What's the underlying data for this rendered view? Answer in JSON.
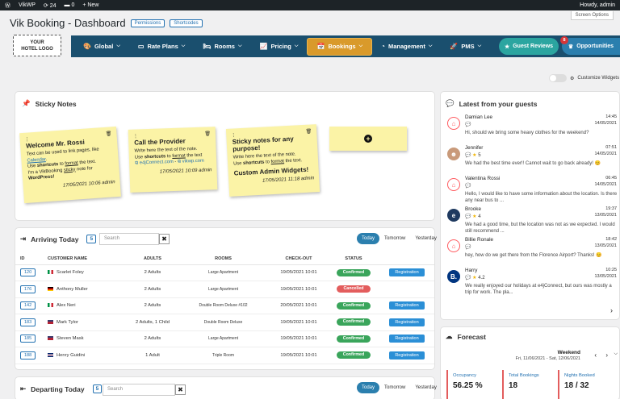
{
  "wpbar": {
    "site": "VikWP",
    "updates": "24",
    "comments": "0",
    "new": "+ New",
    "howdy": "Howdy, admin"
  },
  "screen_options": "Screen Options",
  "page": {
    "title": "Vik Booking - Dashboard",
    "pill1": "Permissions",
    "pill2": "Shortcodes"
  },
  "logo": {
    "line1": "YOUR",
    "line2": "HOTEL LOGO"
  },
  "nav": {
    "items": [
      {
        "label": "Global",
        "icon": "palette-icon"
      },
      {
        "label": "Rate Plans",
        "icon": "card-icon"
      },
      {
        "label": "Rooms",
        "icon": "bed-icon"
      },
      {
        "label": "Pricing",
        "icon": "chart-icon"
      },
      {
        "label": "Bookings",
        "icon": "calendar-icon"
      },
      {
        "label": "Management",
        "icon": "pie-icon"
      },
      {
        "label": "PMS",
        "icon": "rocket-icon"
      }
    ],
    "guest_reviews": "Guest Reviews",
    "opportunities": "Opportunities",
    "opp_badge": "8"
  },
  "customize": "Customize Widgets",
  "sticky": {
    "title": "Sticky Notes",
    "notes": [
      {
        "title": "Welcome Mr. Rossi",
        "body1": "Text can be used to link pages, like",
        "link": "Calendar",
        "body2": "Use",
        "shortcuts": "shortcuts",
        "body3": "to",
        "format": "format",
        "body4": "the text.",
        "body5": "I'm a VikBooking",
        "sticky": "sticky",
        "body6": "note for",
        "wp": "WordPress!",
        "date": "17/05/2021 10:06 admin"
      },
      {
        "title": "Call the Provider",
        "body1": "Write here the text of the note.",
        "body2": "Use",
        "shortcuts": "shortcuts",
        "body3": "to",
        "format": "format",
        "body4": "the text",
        "link1": "e4jConnect.com",
        "sep": "-",
        "link2": "vikwp.com",
        "date": "17/05/2021 10:09 admin"
      },
      {
        "title": "Sticky notes for any purpose!",
        "body1": "Write here the text of the note.",
        "body2": "Use",
        "shortcuts": "shortcuts",
        "body3": "to",
        "format": "format",
        "body4": "the text.",
        "title2": "Custom Admin Widgets!",
        "date": "17/05/2021 11:18 admin"
      }
    ],
    "add": "+"
  },
  "arriving": {
    "title": "Arriving Today",
    "count": "5",
    "search": "Search",
    "tabs": [
      "Today",
      "Tomorrow",
      "Yesterday"
    ],
    "columns": [
      "ID",
      "CUSTOMER NAME",
      "ADULTS",
      "ROOMS",
      "CHECK-OUT",
      "STATUS"
    ],
    "rows": [
      {
        "id": "120",
        "name": "Scarlet Foley",
        "adults": "2 Adults",
        "room": "Large Apartment",
        "checkout": "19/05/2021 10:01",
        "status": "Confirmed",
        "action": "Registration",
        "flag": "it"
      },
      {
        "id": "176",
        "name": "Anthony Muller",
        "adults": "2 Adults",
        "room": "Large Apartment",
        "checkout": "19/05/2021 10:01",
        "status": "Cancelled",
        "action": "",
        "flag": "de"
      },
      {
        "id": "142",
        "name": "Alex Neri",
        "adults": "2 Adults",
        "room": "Double Room Deluxe #102",
        "checkout": "20/05/2021 10:01",
        "status": "Confirmed",
        "action": "Registration",
        "flag": "it"
      },
      {
        "id": "183",
        "name": "Mark Tylor",
        "adults": "2 Adults, 1 Child",
        "room": "Double Room Deluxe",
        "checkout": "19/05/2021 10:01",
        "status": "Confirmed",
        "action": "Registration",
        "flag": "us"
      },
      {
        "id": "185",
        "name": "Steven Mask",
        "adults": "2 Adults",
        "room": "Large Apartment",
        "checkout": "19/05/2021 10:01",
        "status": "Confirmed",
        "action": "Registration",
        "flag": "us"
      },
      {
        "id": "188",
        "name": "Henry Guidini",
        "adults": "1 Adult",
        "room": "Triple Room",
        "checkout": "19/05/2021 10:01",
        "status": "Confirmed",
        "action": "Registration",
        "flag": "uk"
      }
    ]
  },
  "departing": {
    "title": "Departing Today",
    "count": "5",
    "search": "Search",
    "tabs": [
      "Today",
      "Tomorrow",
      "Yesterday"
    ]
  },
  "guests": {
    "title": "Latest from your guests",
    "messages": [
      {
        "name": "Damian Lee",
        "time": "14:45",
        "date": "14/05/2021",
        "text": "Hi, should we bring some heavy clothes for the weekend?",
        "avatar": "airbnb",
        "stars": ""
      },
      {
        "name": "Jennifer",
        "time": "07:51",
        "date": "14/05/2021",
        "text": "We had the best time ever!! Cannot wait to go back already! 😊",
        "avatar": "photo",
        "stars": "5"
      },
      {
        "name": "Valentina Rossi",
        "time": "06:45",
        "date": "14/05/2021",
        "text": "Hello, I would like to have some information about the location. Is there any near bus to ...",
        "avatar": "airbnb",
        "stars": ""
      },
      {
        "name": "Brooke",
        "time": "19:37",
        "date": "13/05/2021",
        "text": "We had a good time, but the location was not as we expected. I would still recommend ...",
        "avatar": "expedia",
        "stars": "4"
      },
      {
        "name": "Billie Ronale",
        "time": "18:42",
        "date": "13/05/2021",
        "text": "hey, how do we get there from the Florence Airport? Thanks! 😊",
        "avatar": "airbnb",
        "stars": ""
      },
      {
        "name": "Harry",
        "time": "10:25",
        "date": "13/05/2021",
        "text": "We really enjoyed our holidays at e4jConnect, but ours was mostly a trip for work. The pla...",
        "avatar": "booking",
        "stars": "4.2"
      }
    ],
    "next": "›"
  },
  "forecast": {
    "title": "Forecast",
    "period": "Weekend",
    "range": "Fri, 11/06/2021 - Sat, 12/06/2021",
    "stats": [
      {
        "label": "Occupancy",
        "value": "56.25 %"
      },
      {
        "label": "Total Bookings",
        "value": "18"
      },
      {
        "label": "Nights Booked",
        "value": "18 / 32"
      }
    ]
  },
  "colors": {
    "nav": "#1a4f6e",
    "active": "#d99a2b",
    "confirmed": "#3aa55b",
    "cancelled": "#e35d5d",
    "link": "#2271b1"
  }
}
